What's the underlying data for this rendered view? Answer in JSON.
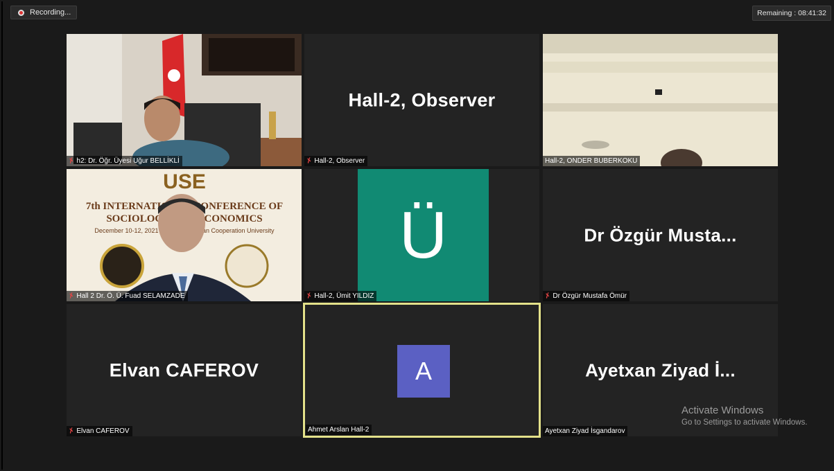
{
  "top_bar": {
    "recording_label": "Recording...",
    "remaining_label": "Remaining : 08:41:32"
  },
  "tiles": [
    {
      "name": "h2: Dr. Öğr. Üyesi Uğur BELLİKLİ",
      "muted": true,
      "type": "video"
    },
    {
      "name": "Hall-2, Observer",
      "muted": true,
      "type": "name",
      "display": "Hall-2, Observer"
    },
    {
      "name": "Hall-2, ONDER BUBERKOKU",
      "muted": false,
      "type": "video"
    },
    {
      "name": "Hall 2 Dr. Ö. Ü. Fuad SELAMZADE",
      "muted": true,
      "type": "video",
      "banner": {
        "l1": "USE",
        "l2": "7th INTERNATIONAL CONFERENCE OF",
        "l3": "SOCIOLOGY AND ECONOMICS",
        "l4": "December 10-12, 2021 / Baku-Azerbaijan Cooperation University"
      }
    },
    {
      "name": "Hall-2, Ümit YILDIZ",
      "muted": true,
      "type": "avatar",
      "letter": "Ü"
    },
    {
      "name": "Dr Özgür Mustafa Ömür",
      "muted": true,
      "type": "name",
      "display": "Dr Özgür Musta..."
    },
    {
      "name": "Elvan CAFEROV",
      "muted": true,
      "type": "name",
      "display": "Elvan CAFEROV"
    },
    {
      "name": "Ahmet Arslan Hall-2",
      "muted": false,
      "type": "avatar",
      "letter": "A",
      "active": true
    },
    {
      "name": "Ayetxan Ziyad İsgandarov",
      "muted": false,
      "type": "name",
      "display": "Ayetxan Ziyad İ..."
    }
  ],
  "watermark": {
    "line1": "Activate Windows",
    "line2": "Go to Settings to activate Windows."
  },
  "colors": {
    "background": "#1a1a1a",
    "tile": "#232323",
    "muted_icon": "#e84545",
    "active_border": "#e3e18a",
    "avatar_a": "#5b60c3",
    "avatar_u": "#118a73"
  }
}
